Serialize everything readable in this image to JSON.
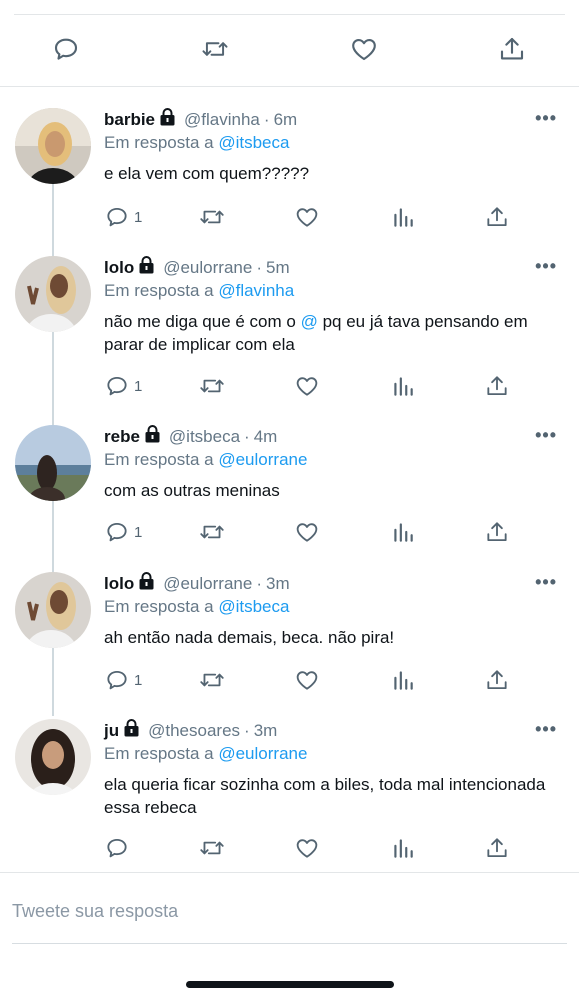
{
  "main_actions": [
    {
      "name": "reply-icon-main",
      "icon": "reply-icon"
    },
    {
      "name": "retweet-icon-main",
      "icon": "retweet-icon"
    },
    {
      "name": "like-icon-main",
      "icon": "heart-icon"
    },
    {
      "name": "share-icon-main",
      "icon": "share-icon"
    }
  ],
  "replying_prefix": "Em resposta a",
  "tweets": [
    {
      "name": "barbie",
      "handle": "@flavinha",
      "time": "6m",
      "reply_to": "@itsbeca",
      "text": "e ela vem com quem?????",
      "reply_count": "1"
    },
    {
      "name": "lolo",
      "handle": "@eulorrane",
      "time": "5m",
      "reply_to": "@flavinha",
      "text_before": "não me diga que é com o ",
      "text_mention": "@",
      "text_after": " pq eu já tava pensando em parar de implicar com ela",
      "reply_count": "1"
    },
    {
      "name": "rebe",
      "handle": "@itsbeca",
      "time": "4m",
      "reply_to": "@eulorrane",
      "text": "com as outras meninas",
      "reply_count": "1"
    },
    {
      "name": "lolo",
      "handle": "@eulorrane",
      "time": "3m",
      "reply_to": "@itsbeca",
      "text": "ah então nada demais, beca. não pira!",
      "reply_count": "1"
    },
    {
      "name": "ju",
      "handle": "@thesoares",
      "time": "3m",
      "reply_to": "@eulorrane",
      "text": "ela queria ficar sozinha com a biles, toda mal intencionada essa rebeca",
      "reply_count": ""
    }
  ],
  "sep": "·",
  "more": "•••",
  "compose": {
    "placeholder": "Tweete sua resposta",
    "value": ""
  },
  "colors": {
    "accent": "#1d9bf0",
    "muted": "#657786",
    "icon": "#536471",
    "text": "#0f1419"
  }
}
